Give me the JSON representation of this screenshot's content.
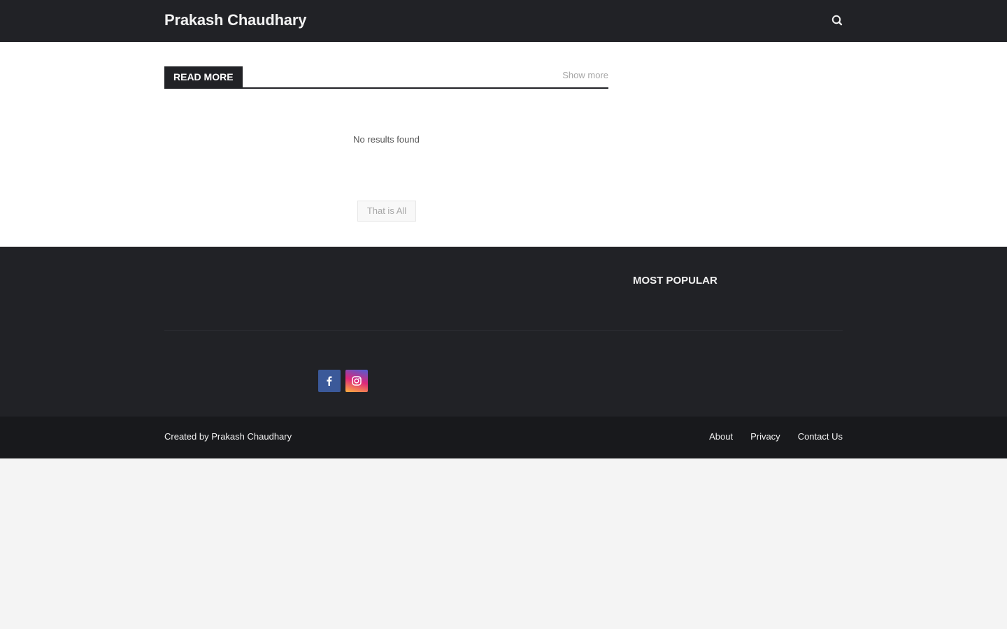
{
  "header": {
    "site_title": "Prakash Chaudhary",
    "search_icon": "search-icon"
  },
  "main": {
    "section_title": "READ MORE",
    "show_more": "Show more",
    "no_results": "No results found",
    "that_is_all": "That is All"
  },
  "footer": {
    "most_popular_title": "MOST POPULAR",
    "social": [
      {
        "name": "facebook",
        "icon": "facebook-icon",
        "color": "#3b5999"
      },
      {
        "name": "instagram",
        "icon": "instagram-icon",
        "color": "#dd277b"
      }
    ]
  },
  "bottom_bar": {
    "created_by_prefix": "Created by ",
    "author": "Prakash Chaudhary",
    "menu": [
      "About",
      "Privacy",
      "Contact Us"
    ]
  },
  "colors": {
    "header_bg": "#212226",
    "footer_bg": "#212226",
    "bottom_bar_bg": "#18191c",
    "page_bg": "#f4f4f4"
  }
}
